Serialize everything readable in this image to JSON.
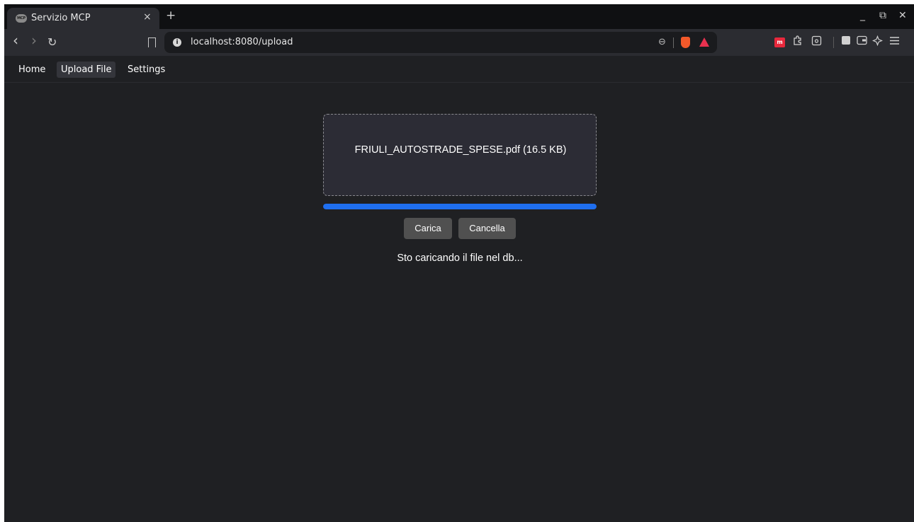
{
  "browser": {
    "tab": {
      "title": "Servizio MCP",
      "favicon_text": "MCP",
      "close": "×"
    },
    "new_tab": "+",
    "window_controls": {
      "minimize": "_",
      "restore": "⧉",
      "close": "✕"
    },
    "url": "localhost:8080/upload",
    "nav": {
      "back": "‹",
      "forward": "›",
      "reload": "↻"
    },
    "zoom": "⊖",
    "site_info": "i",
    "ext_label": "m",
    "toolbar_icons": [
      "puzzle-icon",
      "reader-mode-icon",
      "sidebar-icon",
      "wallet-icon",
      "leo-ai-icon",
      "menu-icon"
    ],
    "colors": {
      "shield": "#f2592a",
      "rewards": "#e8314f",
      "extension": "#e8283c"
    }
  },
  "app": {
    "nav": [
      {
        "label": "Home",
        "active": false
      },
      {
        "label": "Upload File",
        "active": true
      },
      {
        "label": "Settings",
        "active": false
      }
    ],
    "upload": {
      "file_name": "FRIULI_AUTOSTRADE_SPESE.pdf (16.5 KB)",
      "progress": 1.0,
      "upload_button": "Carica",
      "cancel_button": "Cancella",
      "status": "Sto caricando il file nel db..."
    },
    "colors": {
      "accent": "#1f6ff0",
      "background": "#1f2023",
      "dropzone": "#2c2c35",
      "button": "#505050"
    }
  }
}
